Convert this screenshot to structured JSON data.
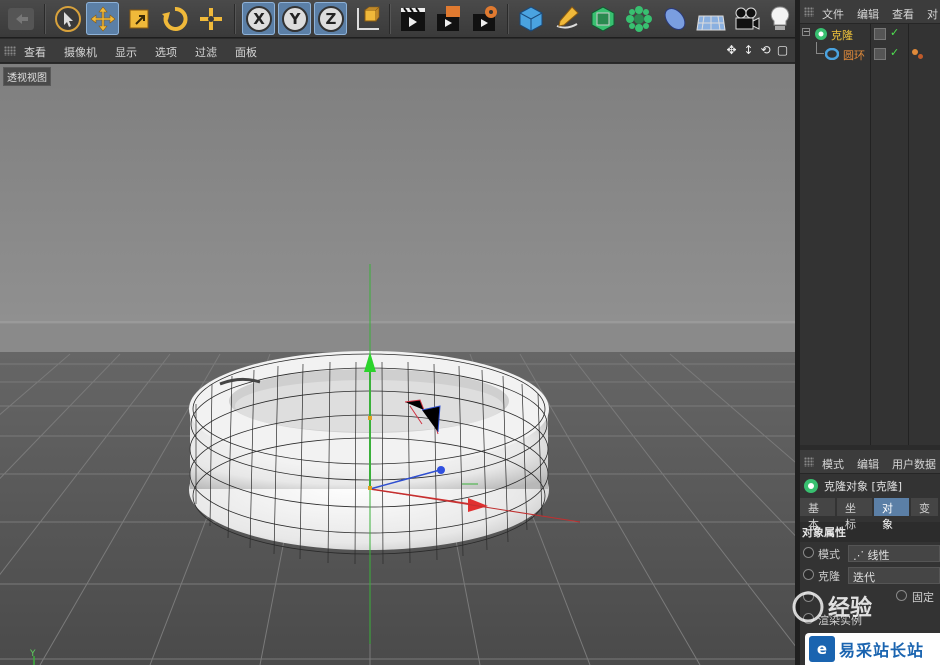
{
  "toolbar": {
    "buttons": [
      "undo-icon",
      "select-icon",
      "move-icon",
      "scale-icon",
      "rotate-icon",
      "live-select-icon",
      "x-axis-icon",
      "y-axis-icon",
      "z-axis-icon",
      "coord-system-icon",
      "render-view-icon",
      "render-picture-icon",
      "render-settings-icon",
      "cube-icon",
      "pen-icon",
      "subdivision-icon",
      "mograph-icon",
      "deformer-icon",
      "floor-icon",
      "camera-icon",
      "light-icon"
    ],
    "axis_x": "X",
    "axis_y": "Y",
    "axis_z": "Z",
    "accent": "#5b7fa6"
  },
  "viewport_menu": {
    "items": [
      "查看",
      "摄像机",
      "显示",
      "选项",
      "过滤",
      "面板"
    ]
  },
  "viewport": {
    "label": "透视视图",
    "axis_corner": "Y"
  },
  "object_manager": {
    "menu": [
      "文件",
      "编辑",
      "查看",
      "对"
    ],
    "objects": [
      {
        "name": "克隆",
        "color": "#f0c43a",
        "icon": "cloner-icon"
      },
      {
        "name": "圆环",
        "color": "#e08a3a",
        "icon": "torus-icon"
      }
    ]
  },
  "attribute_manager": {
    "menu": [
      "模式",
      "编辑",
      "用户数据"
    ],
    "title": "克隆对象 [克隆]",
    "tabs": [
      "基本",
      "坐标",
      "对象",
      "变"
    ],
    "active_tab": "对象",
    "section": "对象属性",
    "mode_label": "模式",
    "mode_value": "线性",
    "clone_label": "克隆",
    "clone_value": "迭代",
    "fixed_label": "固定",
    "render_instance_label": "渲染实例"
  },
  "watermark": {
    "text1": "经验",
    "text2": "易采站长站",
    "letter": "e"
  }
}
